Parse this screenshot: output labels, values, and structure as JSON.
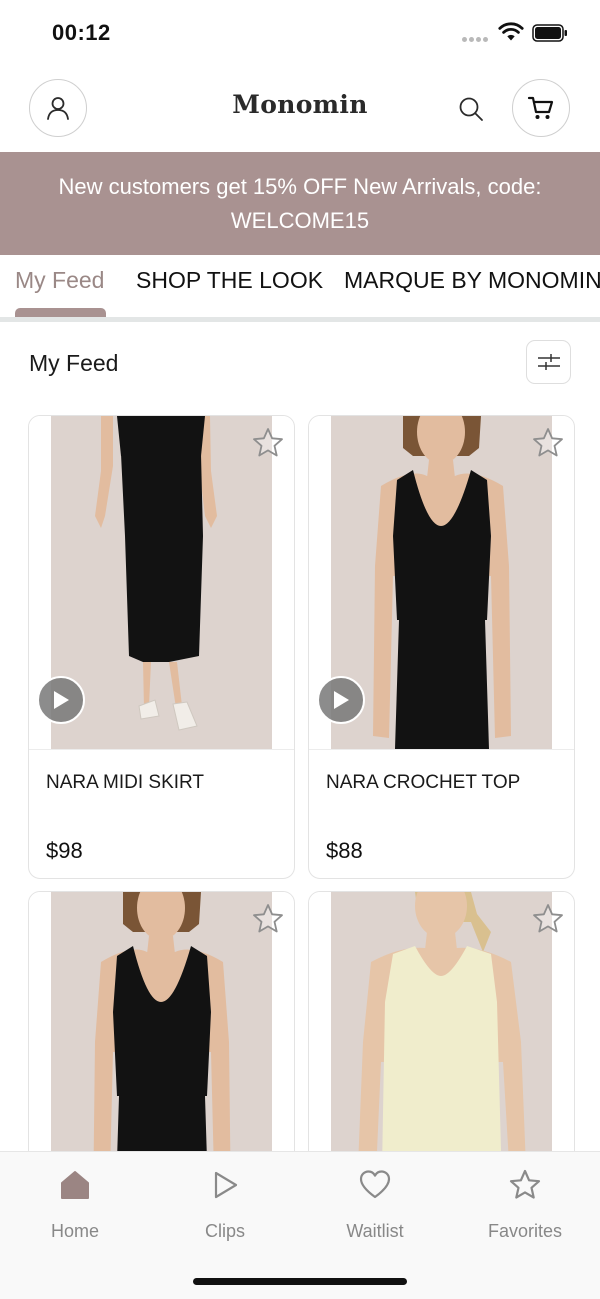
{
  "status_bar": {
    "time": "00:12",
    "icons": [
      "signal-dots-icon",
      "wifi-icon",
      "battery-icon"
    ]
  },
  "header": {
    "brand": "Monomin",
    "icons": [
      "account-icon",
      "search-icon",
      "cart-icon"
    ]
  },
  "promo": {
    "line1": "New customers get 15% OFF New Arrivals, code:",
    "line2": "WELCOME15"
  },
  "tabs": [
    {
      "label": "My Feed",
      "active": true
    },
    {
      "label": "SHOP THE LOOK",
      "active": false
    },
    {
      "label": "MARQUE BY MONOMIN",
      "active": false
    }
  ],
  "feed": {
    "title": "My Feed",
    "filter_icon": "sliders-icon"
  },
  "products": [
    {
      "name": "NARA MIDI SKIRT",
      "price": "$98",
      "has_video": true,
      "garment_color": "#121212"
    },
    {
      "name": "NARA CROCHET TOP",
      "price": "$88",
      "has_video": true,
      "garment_color": "#121212"
    },
    {
      "name": "",
      "price": "",
      "has_video": false,
      "garment_color": "#121212"
    },
    {
      "name": "",
      "price": "",
      "has_video": false,
      "garment_color": "#f0edcc"
    }
  ],
  "bottom_nav": [
    {
      "label": "Home",
      "icon": "home-icon",
      "active": true
    },
    {
      "label": "Clips",
      "icon": "play-icon",
      "active": false
    },
    {
      "label": "Waitlist",
      "icon": "heart-icon",
      "active": false
    },
    {
      "label": "Favorites",
      "icon": "star-icon",
      "active": false
    }
  ],
  "colors": {
    "accent": "#a99291",
    "active_tab_text": "#9a8886",
    "photo_background": "#ddd3ce",
    "nav_active_icon": "#9b8583",
    "nav_inactive": "#888888"
  }
}
